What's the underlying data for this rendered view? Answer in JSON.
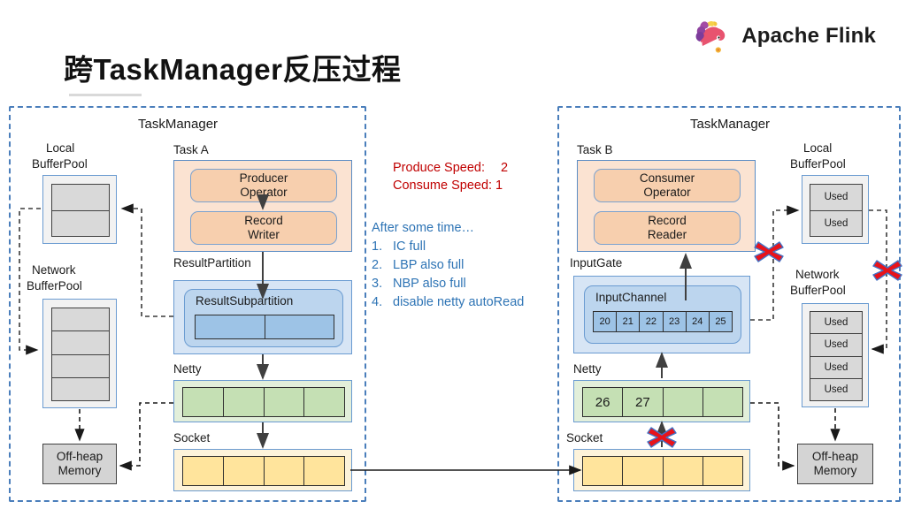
{
  "brand": {
    "name": "Apache Flink",
    "logo_icon": "flink-squirrel-logo"
  },
  "page_title": "跨TaskManager反压过程",
  "left_tm": {
    "title": "TaskManager",
    "local_bufferpool": {
      "label_line1": "Local",
      "label_line2": "BufferPool",
      "cells": [
        "",
        ""
      ]
    },
    "network_bufferpool": {
      "label_line1": "Network",
      "label_line2": "BufferPool",
      "cells": [
        "",
        "",
        "",
        ""
      ]
    },
    "offheap": {
      "line1": "Off-heap",
      "line2": "Memory"
    },
    "task": {
      "caption": "Task A",
      "op1_line1": "Producer",
      "op1_line2": "Operator",
      "op2_line1": "Record",
      "op2_line2": "Writer"
    },
    "result_partition": {
      "caption": "ResultPartition",
      "subpartition_label": "ResultSubpartition",
      "cells": [
        "",
        ""
      ]
    },
    "netty": {
      "caption": "Netty",
      "cells": [
        "",
        "",
        "",
        ""
      ]
    },
    "socket": {
      "caption": "Socket",
      "cells": [
        "",
        "",
        "",
        ""
      ]
    }
  },
  "center_notes": {
    "produce_label": "Produce Speed:",
    "produce_value": "2",
    "consume_label": "Consume Speed:",
    "consume_value": "1",
    "after_heading": "After some time…",
    "steps": [
      {
        "num": "1.",
        "text": "IC  full"
      },
      {
        "num": "2.",
        "text": "LBP also full"
      },
      {
        "num": "3.",
        "text": "NBP also full"
      },
      {
        "num": "4.",
        "text": "disable netty autoRead"
      }
    ]
  },
  "right_tm": {
    "title": "TaskManager",
    "task": {
      "caption": "Task B",
      "op1_line1": "Consumer",
      "op1_line2": "Operator",
      "op2_line1": "Record",
      "op2_line2": "Reader"
    },
    "input_gate": {
      "caption": "InputGate",
      "channel_label": "InputChannel",
      "cells": [
        "20",
        "21",
        "22",
        "23",
        "24",
        "25"
      ]
    },
    "netty": {
      "caption": "Netty",
      "cells": [
        "26",
        "27",
        "",
        ""
      ]
    },
    "socket": {
      "caption": "Socket",
      "cells": [
        "",
        "",
        "",
        ""
      ]
    },
    "local_bufferpool": {
      "label_line1": "Local",
      "label_line2": "BufferPool",
      "cells": [
        "Used",
        "Used"
      ]
    },
    "network_bufferpool": {
      "label_line1": "Network",
      "label_line2": "BufferPool",
      "cells": [
        "Used",
        "Used",
        "Used",
        "Used"
      ]
    },
    "offheap": {
      "line1": "Off-heap",
      "line2": "Memory"
    }
  },
  "colors": {
    "tm_border": "#4a7ebb",
    "red_accent": "#c00000",
    "blue_accent": "#2e74b5",
    "orange_fill": "#f7cfae",
    "blue_fill": "#9dc3e6",
    "green_fill": "#c5e0b4",
    "yellow_fill": "#ffe49c",
    "gray_fill": "#d9d9d9",
    "x_mark": "#e8131a"
  },
  "blocked_markers": 4
}
